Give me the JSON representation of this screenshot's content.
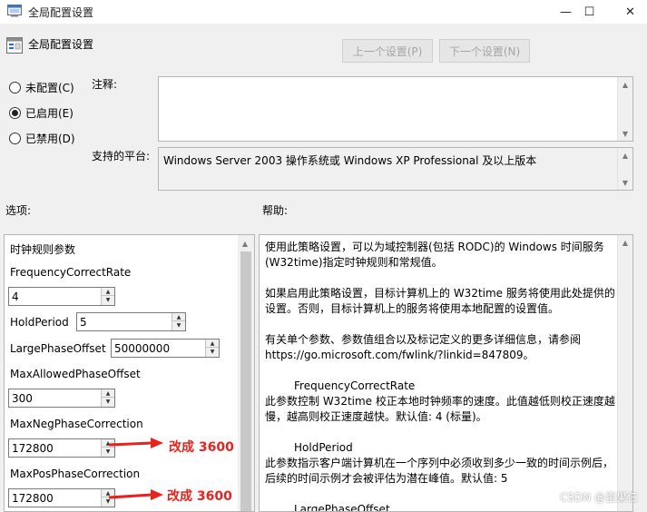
{
  "window": {
    "title": "全局配置设置",
    "minimize": "—",
    "maximize": "☐",
    "close": "✕"
  },
  "header": {
    "title": "全局配置设置",
    "prev_button": "上一个设置(P)",
    "next_button": "下一个设置(N)"
  },
  "state": {
    "options": [
      {
        "label": "未配置(C)",
        "selected": false
      },
      {
        "label": "已启用(E)",
        "selected": true
      },
      {
        "label": "已禁用(D)",
        "selected": false
      }
    ]
  },
  "comment": {
    "label": "注释:",
    "value": ""
  },
  "platform": {
    "label": "支持的平台:",
    "value": "Windows Server 2003 操作系统或 Windows XP Professional 及以上版本"
  },
  "options_panel": {
    "label": "选项:",
    "section_title": "时钟规则参数",
    "fields": [
      {
        "name": "FrequencyCorrectRate",
        "value": "4"
      },
      {
        "name": "HoldPeriod",
        "value": "5"
      },
      {
        "name": "LargePhaseOffset",
        "value": "50000000"
      },
      {
        "name": "MaxAllowedPhaseOffset",
        "value": "300"
      },
      {
        "name": "MaxNegPhaseCorrection",
        "value": "172800"
      },
      {
        "name": "MaxPosPhaseCorrection",
        "value": "172800"
      }
    ]
  },
  "help_panel": {
    "label": "帮助:",
    "paragraphs": [
      "使用此策略设置，可以为域控制器(包括 RODC)的 Windows 时间服务 (W32time)指定时钟规则和常规值。",
      "如果启用此策略设置，目标计算机上的 W32time 服务将使用此处提供的设置。否则，目标计算机上的服务将使用本地配置的设置值。",
      "有关单个参数、参数值组合以及标记定义的更多详细信息，请参阅 https://go.microsoft.com/fwlink/?linkid=847809。"
    ],
    "entries": [
      {
        "title": "FrequencyCorrectRate",
        "desc": "此参数控制 W32time 校正本地时钟频率的速度。此值越低则校正速度越慢，越高则校正速度越快。默认值: 4 (标量)。"
      },
      {
        "title": "HoldPeriod",
        "desc": "此参数指示客户端计算机在一个序列中必须收到多少一致的时间示例后，后续的时间示例才会被评估为潜在峰值。默认值: 5"
      },
      {
        "title": "LargePhaseOffset",
        "desc": ""
      }
    ]
  },
  "annotations": [
    {
      "text": "改成 3600",
      "target": "MaxNegPhaseCorrection"
    },
    {
      "text": "改成 3600",
      "target": "MaxPosPhaseCorrection"
    }
  ],
  "colors": {
    "annotation": "#e8231e"
  },
  "watermark": "CSDN @歪果仨"
}
